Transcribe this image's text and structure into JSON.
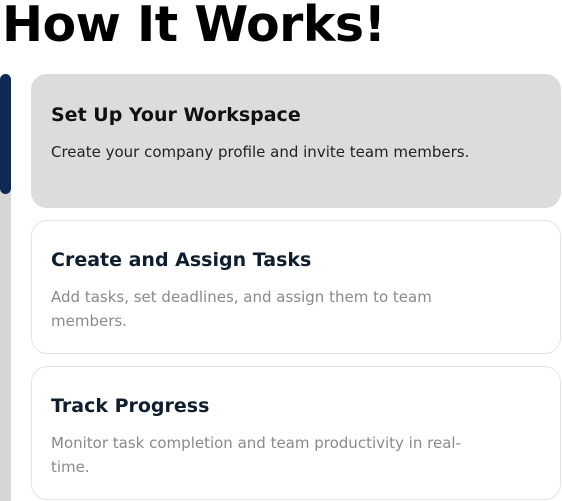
{
  "page": {
    "title": "How It Works!"
  },
  "colors": {
    "progress_fill": "#0d2a57",
    "progress_track": "#d6d6d6",
    "active_card": "#dcdcdc",
    "inactive_card": "#ffffff"
  },
  "progress": {
    "active_step": 1,
    "total_steps": 3
  },
  "steps": [
    {
      "title": "Set Up Your Workspace",
      "description": "Create your company profile and invite team members.",
      "active": true
    },
    {
      "title": "Create and Assign Tasks",
      "description": "Add tasks, set deadlines, and assign them to team members.",
      "active": false
    },
    {
      "title": "Track Progress",
      "description": "Monitor task completion and team productivity in real-time.",
      "active": false
    }
  ]
}
